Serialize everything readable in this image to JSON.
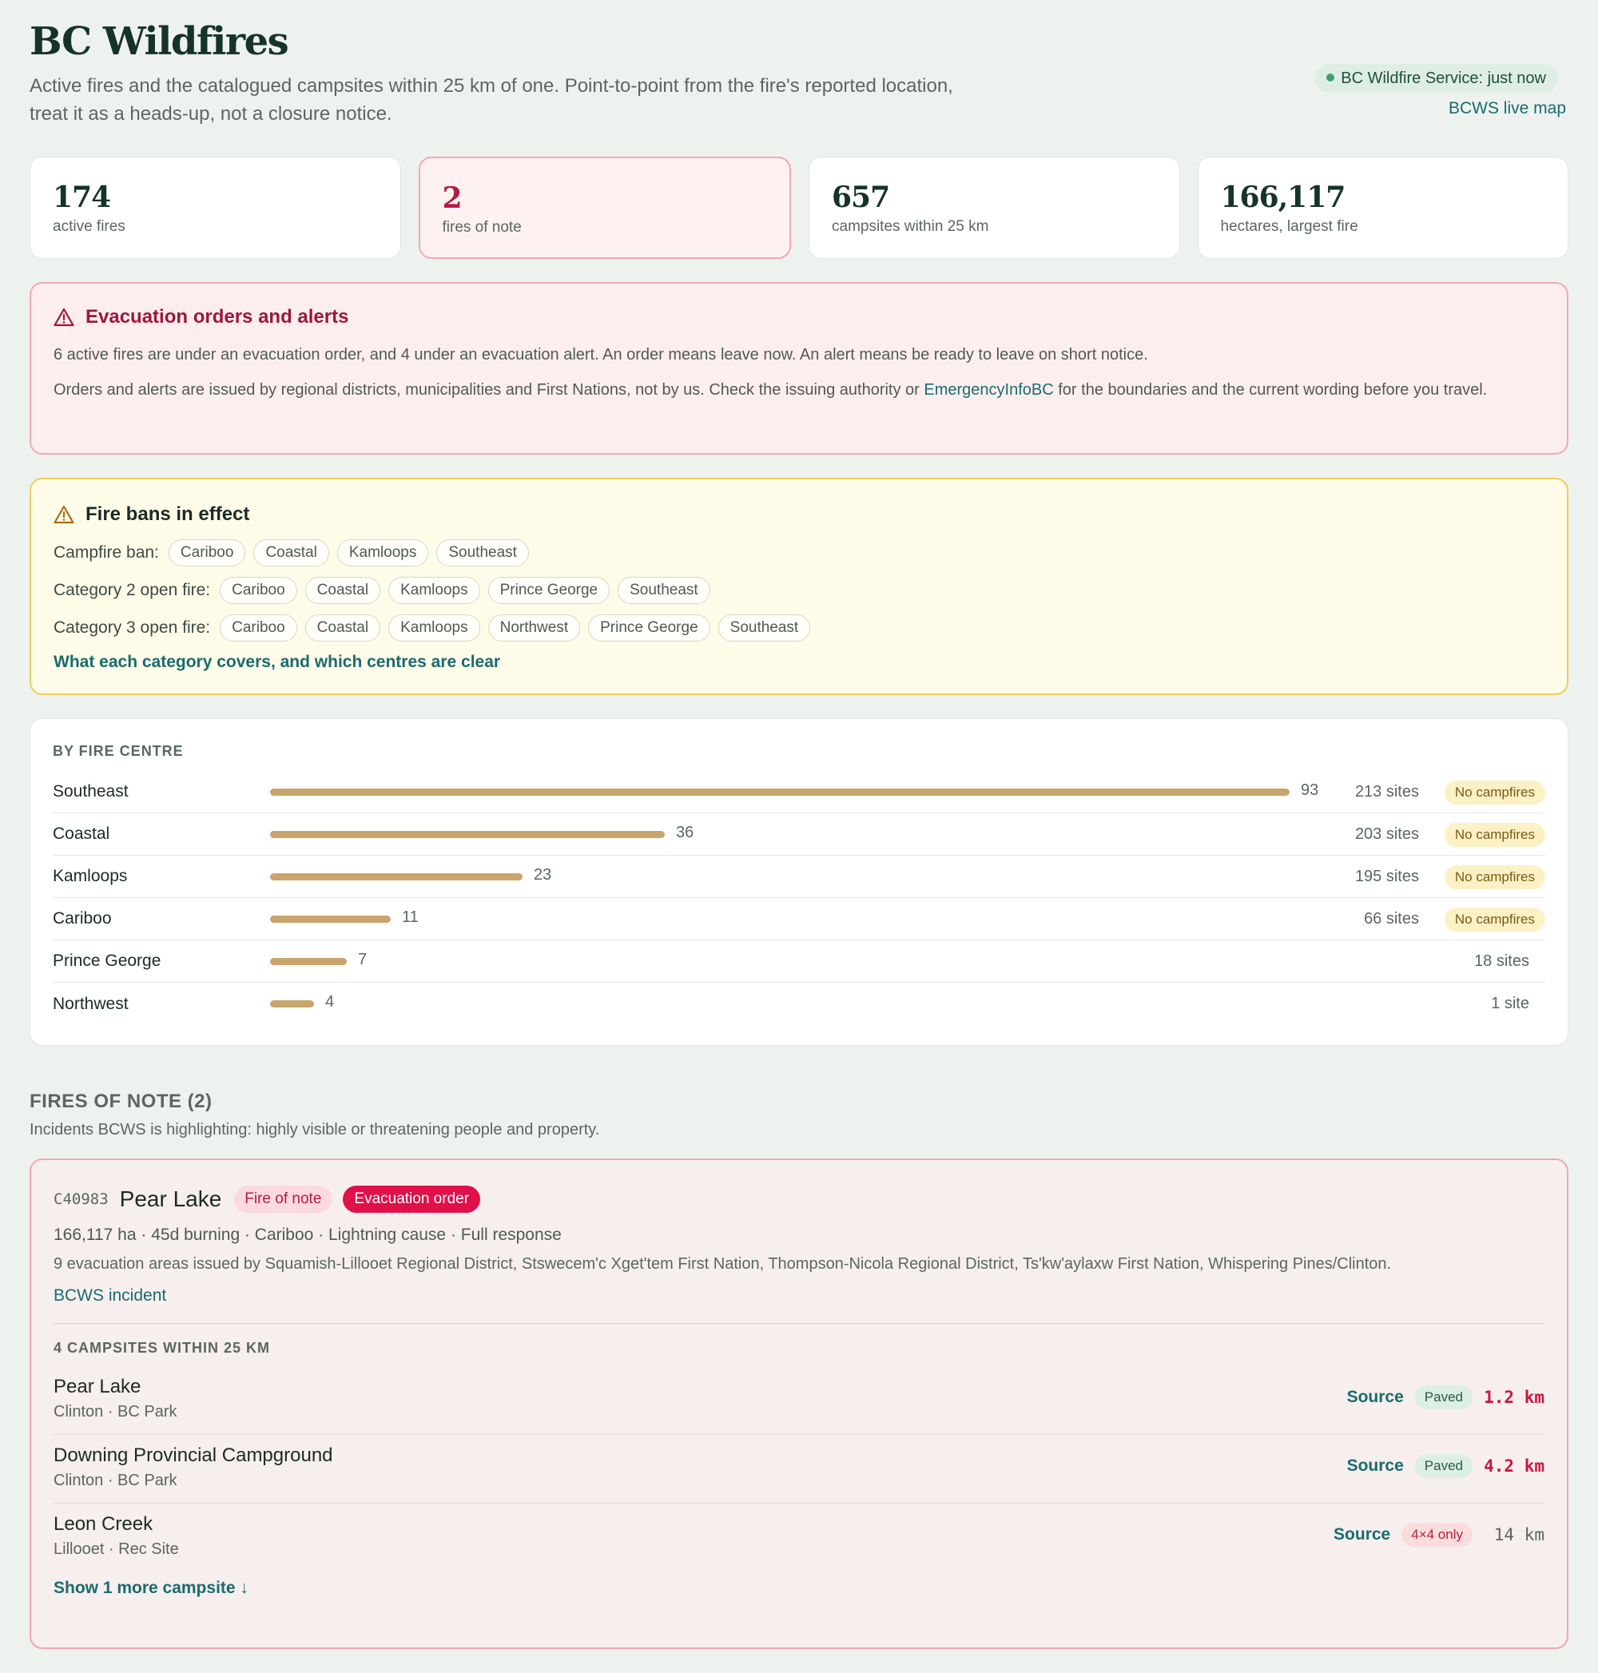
{
  "header": {
    "title": "BC Wildfires",
    "subtitle": "Active fires and the catalogued campsites within 25 km of one. Point-to-point from the fire's reported location, treat it as a heads-up, not a closure notice.",
    "status": "BC Wildfire Service: just now",
    "live_map_link": "BCWS live map"
  },
  "stats": [
    {
      "value": "174",
      "label": "active fires"
    },
    {
      "value": "2",
      "label": "fires of note"
    },
    {
      "value": "657",
      "label": "campsites within 25 km"
    },
    {
      "value": "166,117",
      "label": "hectares, largest fire"
    }
  ],
  "evacuation": {
    "heading": "Evacuation orders and alerts",
    "paragraph1": "6 active fires are under an evacuation order, and 4 under an evacuation alert. An order means leave now. An alert means be ready to leave on short notice.",
    "paragraph2_before": "Orders and alerts are issued by regional districts, municipalities and First Nations, not by us. Check the issuing authority or ",
    "paragraph2_link": "EmergencyInfoBC",
    "paragraph2_after": " for the boundaries and the current wording before you travel."
  },
  "fire_bans": {
    "heading": "Fire bans in effect",
    "rows": [
      {
        "label": "Campfire ban:",
        "centres": [
          "Cariboo",
          "Coastal",
          "Kamloops",
          "Southeast"
        ]
      },
      {
        "label": "Category 2 open fire:",
        "centres": [
          "Cariboo",
          "Coastal",
          "Kamloops",
          "Prince George",
          "Southeast"
        ]
      },
      {
        "label": "Category 3 open fire:",
        "centres": [
          "Cariboo",
          "Coastal",
          "Kamloops",
          "Northwest",
          "Prince George",
          "Southeast"
        ]
      }
    ],
    "link": "What each category covers, and which centres are clear"
  },
  "by_centre": {
    "heading": "BY FIRE CENTRE",
    "max_fires": 93,
    "rows": [
      {
        "name": "Southeast",
        "fires": 93,
        "sites": "213 sites",
        "badge": "No campfires"
      },
      {
        "name": "Coastal",
        "fires": 36,
        "sites": "203 sites",
        "badge": "No campfires"
      },
      {
        "name": "Kamloops",
        "fires": 23,
        "sites": "195 sites",
        "badge": "No campfires"
      },
      {
        "name": "Cariboo",
        "fires": 11,
        "sites": "66 sites",
        "badge": "No campfires"
      },
      {
        "name": "Prince George",
        "fires": 7,
        "sites": "18 sites",
        "badge": ""
      },
      {
        "name": "Northwest",
        "fires": 4,
        "sites": "1 site",
        "badge": ""
      }
    ]
  },
  "fires_of_note": {
    "heading": "FIRES OF NOTE (2)",
    "subheading": "Incidents BCWS is highlighting: highly visible or threatening people and property.",
    "fire": {
      "id": "C40983",
      "name": "Pear Lake",
      "note_pill": "Fire of note",
      "evac_pill": "Evacuation order",
      "meta": "166,117 ha · 45d burning · Cariboo · Lightning cause · Full response",
      "areas": "9 evacuation areas issued by Squamish-Lillooet Regional District, Stswecem'c Xget'tem First Nation, Thompson-Nicola Regional District, Ts'kw'aylaxw First Nation, Whispering Pines/Clinton.",
      "incident_link": "BCWS incident",
      "campsites_heading": "4 CAMPSITES WITHIN 25 KM",
      "campsites": [
        {
          "name": "Pear Lake",
          "sub": "Clinton · BC Park",
          "source": "Source",
          "road": "Paved",
          "distance": "1.2 km"
        },
        {
          "name": "Downing Provincial Campground",
          "sub": "Clinton · BC Park",
          "source": "Source",
          "road": "Paved",
          "distance": "4.2 km"
        },
        {
          "name": "Leon Creek",
          "sub": "Lillooet · Rec Site",
          "source": "Source",
          "road": "4×4 only",
          "distance": "14 km"
        }
      ],
      "show_more": "Show 1 more campsite ↓"
    }
  },
  "colors": {
    "background": "#eef2ef",
    "accent_teal": "#1a6b6e",
    "danger": "#e0104a",
    "bar": "#c9a46c"
  }
}
